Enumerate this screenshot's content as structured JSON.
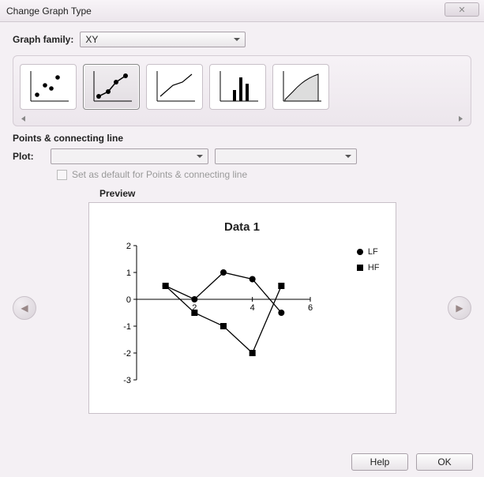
{
  "window": {
    "title": "Change Graph Type"
  },
  "graph_family": {
    "label": "Graph family:",
    "value": "XY"
  },
  "gallery": {
    "types": [
      "scatter",
      "connected-scatter",
      "line",
      "column",
      "area"
    ],
    "selected_index": 1
  },
  "section": {
    "heading": "Points & connecting line",
    "plot_label": "Plot:",
    "plot_selected": "",
    "subtype_selected": "",
    "default_checkbox_label": "Set as default for Points & connecting line",
    "default_checked": false
  },
  "preview": {
    "label": "Preview"
  },
  "chart_data": {
    "type": "line",
    "title": "Data 1",
    "xlabel": "",
    "ylabel": "",
    "xlim": [
      0,
      6
    ],
    "ylim": [
      -3,
      2
    ],
    "x_ticks": [
      2,
      4,
      6
    ],
    "y_ticks": [
      -3,
      -2,
      -1,
      0,
      1,
      2
    ],
    "x": [
      1,
      2,
      3,
      4,
      5
    ],
    "series": [
      {
        "name": "LF",
        "marker": "circle",
        "values": [
          0.5,
          0.0,
          1.0,
          0.75,
          -0.5
        ]
      },
      {
        "name": "HF",
        "marker": "square",
        "values": [
          0.5,
          -0.5,
          -1.0,
          -2.0,
          0.5
        ]
      }
    ]
  },
  "buttons": {
    "help": "Help",
    "ok": "OK"
  }
}
